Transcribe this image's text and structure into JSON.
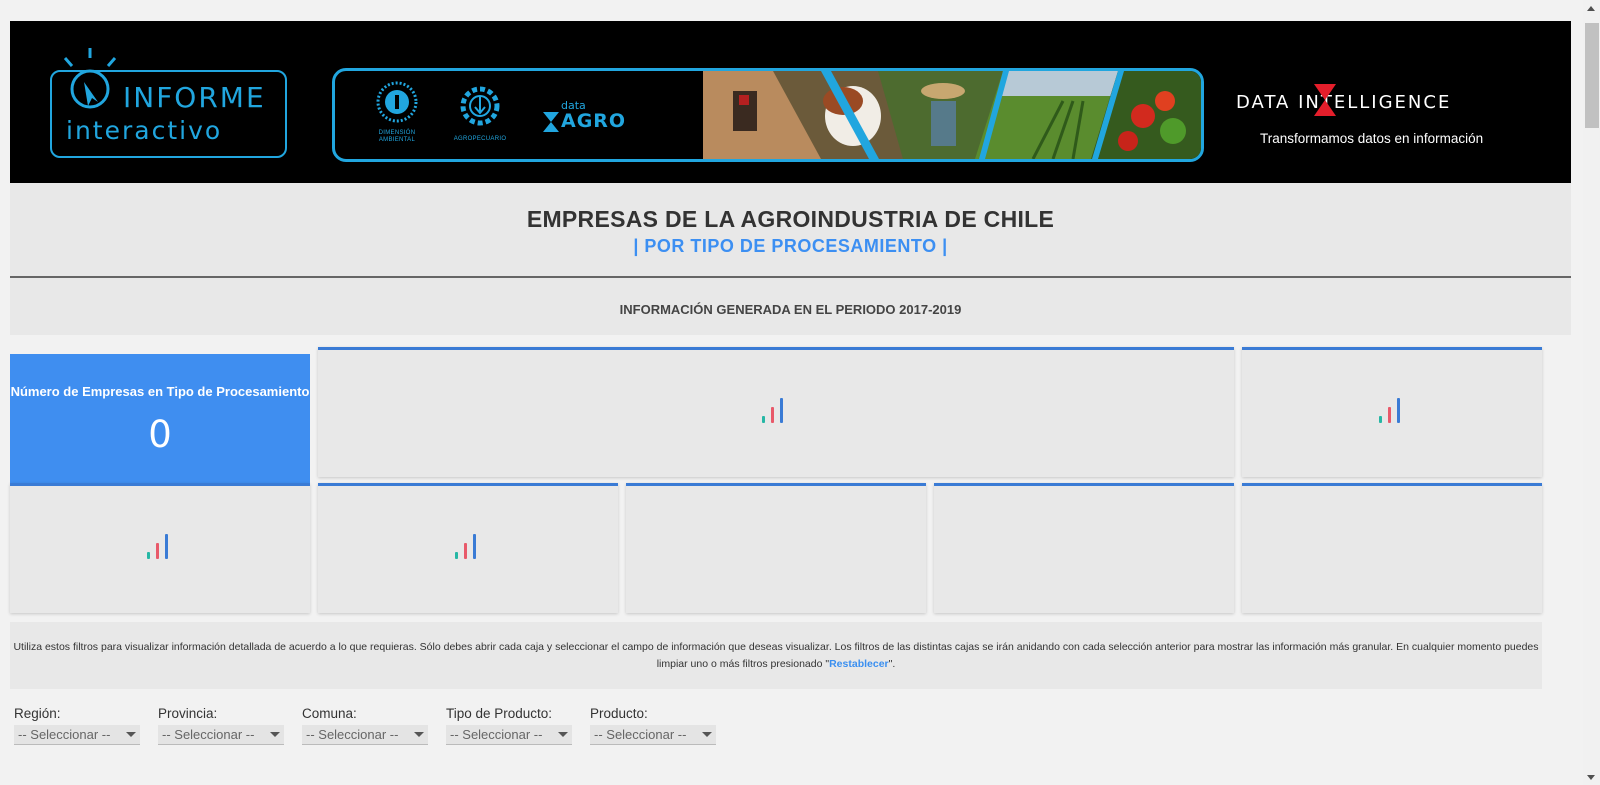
{
  "header": {
    "logo_line1": "INFORME",
    "logo_line2": "interactivo",
    "partner1_caption": "DIMENSIÓN AMBIENTAL",
    "partner2_caption": "AGROPECUARIO",
    "dataagro_small": "data",
    "dataagro_big": "AGRO",
    "company_name": "DATA INTELLIGENCE",
    "tagline": "Transformamos datos en información"
  },
  "titles": {
    "main": "EMPRESAS DE LA AGROINDUSTRIA DE CHILE",
    "sub": "| POR TIPO DE PROCESAMIENTO |",
    "period": "INFORMACIÓN GENERADA EN EL PERIODO 2017-2019"
  },
  "kpi": {
    "label": "Número de Empresas en Tipo de Procesamiento",
    "value": "0"
  },
  "info": {
    "text_before": "Utiliza estos filtros para visualizar información detallada de acuerdo a lo que requieras. Sólo debes abrir cada caja y seleccionar el campo de información que deseas visualizar. Los filtros de las distintas cajas se irán anidando con cada selección anterior para mostrar las información más granular. En cualquier momento puedes limpiar uno o más filtros presionado \"",
    "link": "Restablecer",
    "text_after": "\"."
  },
  "filters": [
    {
      "label": "Región:",
      "value": "-- Seleccionar --"
    },
    {
      "label": "Provincia:",
      "value": "-- Seleccionar --"
    },
    {
      "label": "Comuna:",
      "value": "-- Seleccionar --"
    },
    {
      "label": "Tipo de Producto:",
      "value": "-- Seleccionar --"
    },
    {
      "label": "Producto:",
      "value": "-- Seleccionar --"
    }
  ],
  "colors": {
    "brand_blue": "#21a6df",
    "kpi_blue": "#3f8ef0",
    "card_border": "#3a7bd5",
    "loader_teal": "#26b7a5",
    "loader_red": "#e8596a"
  }
}
